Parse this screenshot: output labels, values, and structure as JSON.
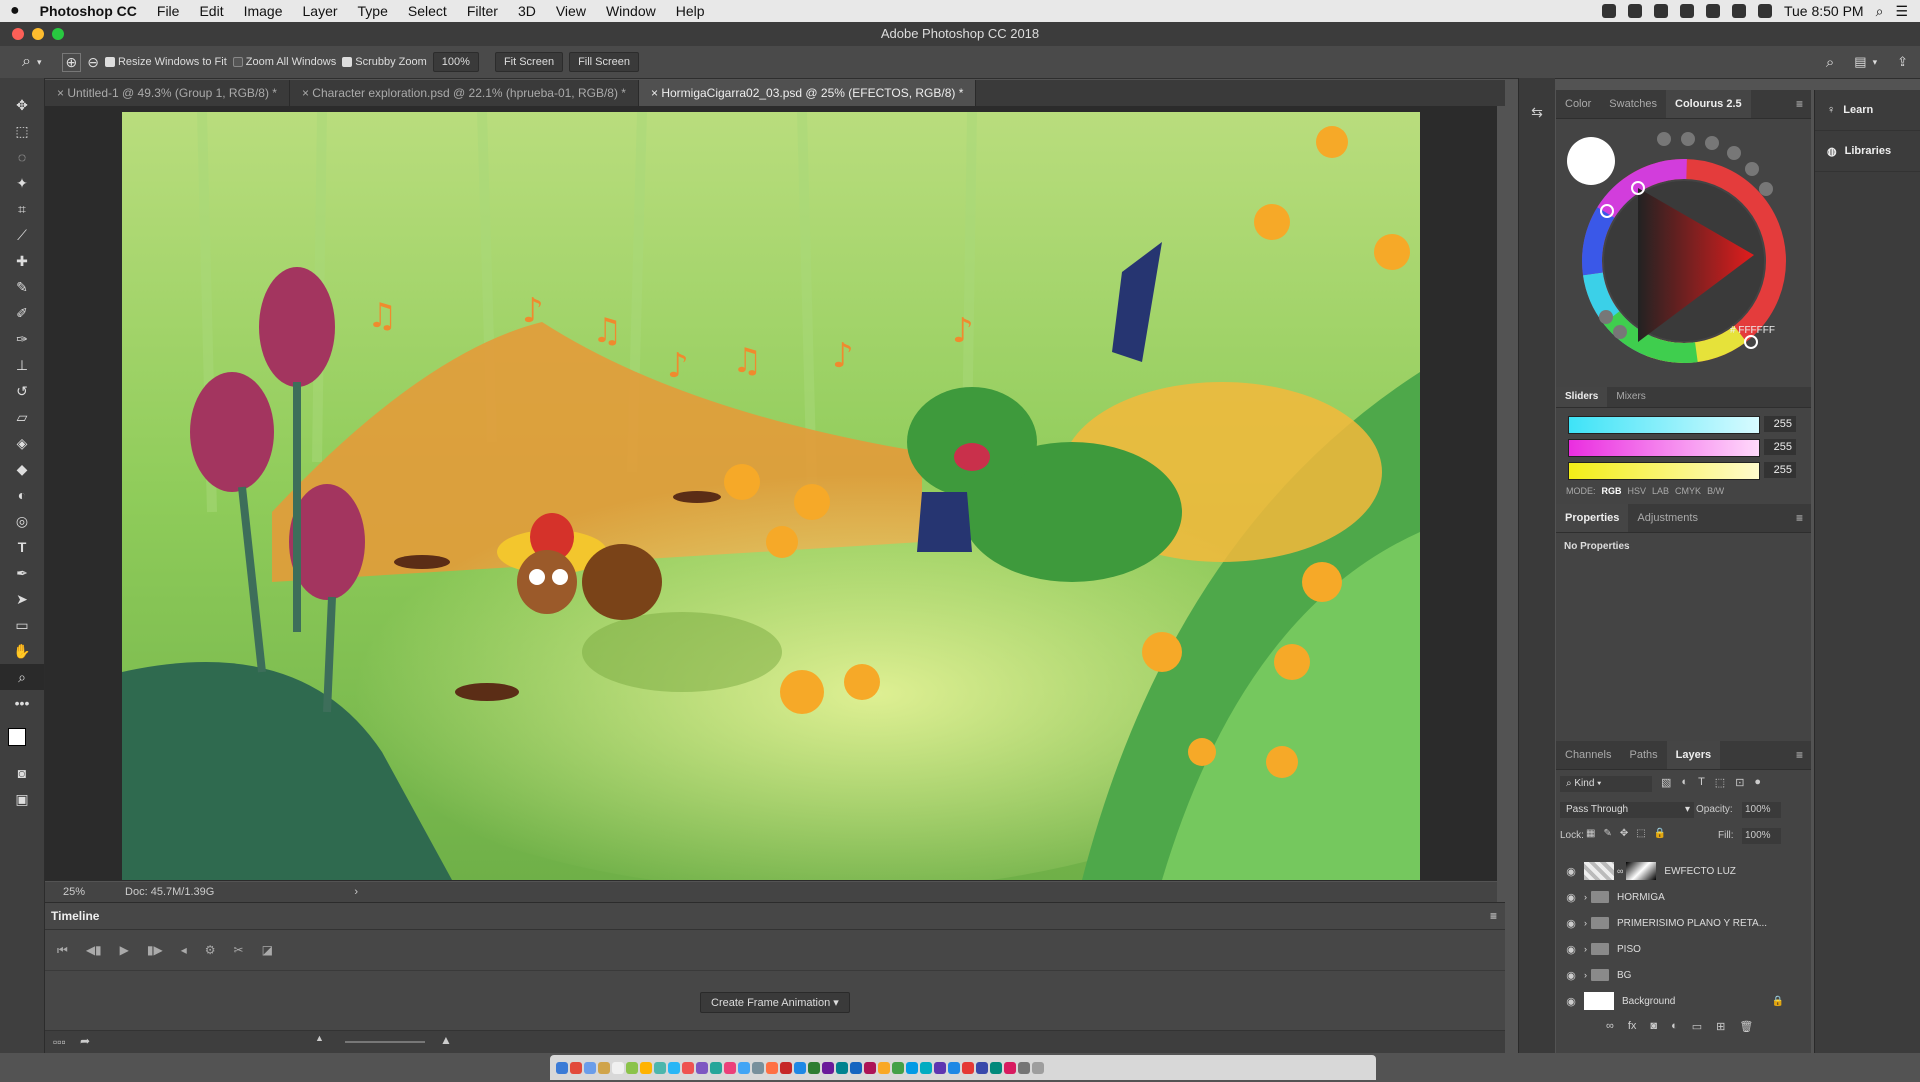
{
  "menubar": {
    "apple": "",
    "items": [
      "Photoshop CC",
      "File",
      "Edit",
      "Image",
      "Layer",
      "Type",
      "Select",
      "Filter",
      "3D",
      "View",
      "Window",
      "Help"
    ],
    "clock": "Tue 8:50 PM"
  },
  "window": {
    "title": "Adobe Photoshop CC 2018"
  },
  "options": {
    "resize_label": "Resize Windows to Fit",
    "zoom_all_label": "Zoom All Windows",
    "scrubby_label": "Scrubby Zoom",
    "zoom_value": "100%",
    "fit_screen": "Fit Screen",
    "fill_screen": "Fill Screen"
  },
  "tabs": [
    "Untitled-1 @ 49.3% (Group 1, RGB/8) *",
    "Character exploration.psd @ 22.1% (hprueba-01, RGB/8) *",
    "HormigaCigarra02_03.psd @ 25% (EFECTOS, RGB/8) *"
  ],
  "status": {
    "zoom": "25%",
    "doc": "Doc: 45.7M/1.39G"
  },
  "timeline": {
    "title": "Timeline",
    "create_button": "Create Frame Animation"
  },
  "color_panel": {
    "tabs": [
      "Color",
      "Swatches",
      "Colourus 2.5"
    ],
    "hex": "# FFFFFF",
    "slider_tabs": [
      "Sliders",
      "Mixers"
    ],
    "sliders": [
      {
        "label": "C",
        "value": "255"
      },
      {
        "label": "M",
        "value": "255"
      },
      {
        "label": "Y",
        "value": "255"
      }
    ],
    "modes_label": "MODE:",
    "modes": [
      "RGB",
      "HSV",
      "LAB",
      "CMYK",
      "B/W"
    ]
  },
  "properties_panel": {
    "tabs": [
      "Properties",
      "Adjustments"
    ],
    "empty": "No Properties"
  },
  "layers_panel": {
    "tabs": [
      "Channels",
      "Paths",
      "Layers"
    ],
    "kind": "Kind",
    "blend": "Pass Through",
    "opacity_label": "Opacity:",
    "opacity": "100%",
    "lock_label": "Lock:",
    "fill_label": "Fill:",
    "fill": "100%",
    "layers": [
      "EWFECTO LUZ",
      "HORMIGA",
      "PRIMERISIMO PLANO Y RETA...",
      "PISO",
      "BG",
      "Background"
    ]
  },
  "side": {
    "learn": "Learn",
    "libraries": "Libraries"
  }
}
